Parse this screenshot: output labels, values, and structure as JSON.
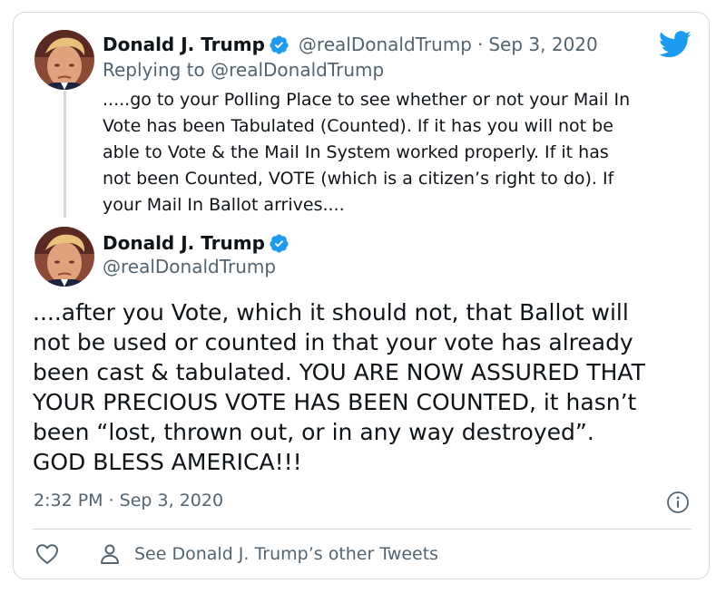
{
  "reply_tweet": {
    "display_name": "Donald J. Trump",
    "handle": "@realDonaldTrump",
    "separator": "·",
    "date": "Sep 3, 2020",
    "replying_to": "Replying to @realDonaldTrump",
    "text": ".....go to your Polling Place to see whether or not your Mail In\nVote has been Tabulated (Counted). If it has you will not be\nable to Vote & the Mail In System worked properly. If it has\nnot been Counted, VOTE (which is a citizen’s right to do). If\nyour Mail In Ballot arrives...."
  },
  "main_tweet": {
    "display_name": "Donald J. Trump",
    "handle": "@realDonaldTrump",
    "text": "....after you Vote, which it should not, that Ballot will\nnot be used or counted in that your vote has already\nbeen cast & tabulated. YOU ARE NOW ASSURED THAT\nYOUR PRECIOUS VOTE HAS BEEN COUNTED, it hasn’t\nbeen “lost, thrown out, or in any way destroyed”.\nGOD BLESS AMERICA!!!",
    "timestamp": "2:32 PM · Sep 3, 2020"
  },
  "actions": {
    "other_tweets_label": "See Donald J. Trump’s other Tweets"
  },
  "icons": {
    "verified": "verified-badge-icon",
    "twitter": "twitter-bird-icon",
    "info": "info-icon",
    "like": "heart-icon",
    "profile": "person-icon"
  },
  "colors": {
    "brand_blue": "#1d9bf0",
    "text_primary": "#0f1419",
    "text_secondary": "#536471",
    "border": "#cfd9de"
  }
}
